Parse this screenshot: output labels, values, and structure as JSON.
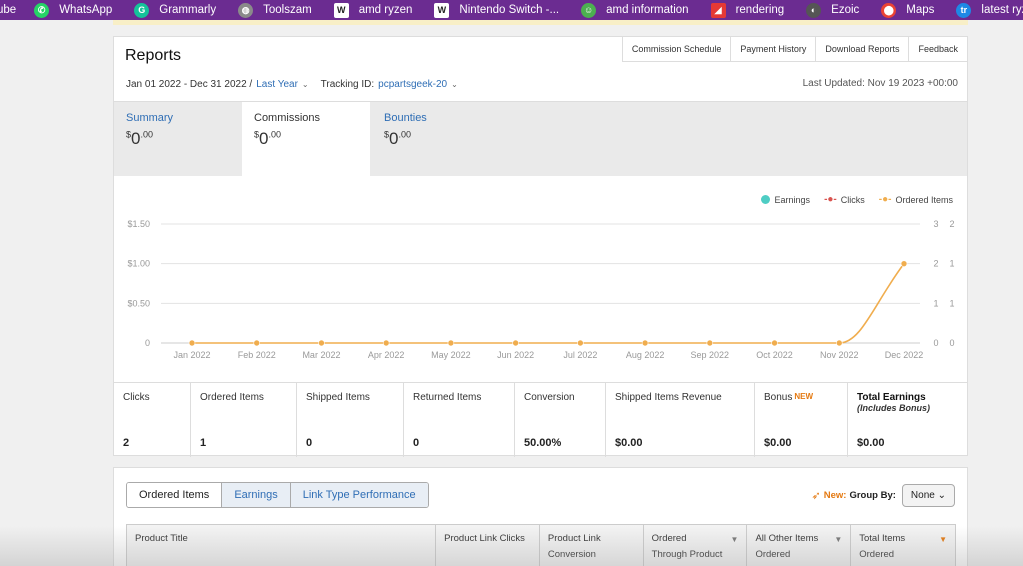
{
  "bookmarks": [
    {
      "label": "ube",
      "icon": ""
    },
    {
      "label": "WhatsApp",
      "icon": "whatsapp-icon",
      "color": "#25d366"
    },
    {
      "label": "Grammarly",
      "icon": "grammarly-icon",
      "color": "#15c39a"
    },
    {
      "label": "Toolszam",
      "icon": "globe-icon",
      "color": "#777777"
    },
    {
      "label": "amd ryzen",
      "icon": "wikipedia-icon",
      "color": "#ffffff"
    },
    {
      "label": "Nintendo Switch -...",
      "icon": "wikipedia-icon",
      "color": "#ffffff"
    },
    {
      "label": "amd information",
      "icon": "smiley-icon",
      "color": "#4caf50"
    },
    {
      "label": "rendering",
      "icon": "rendering-icon",
      "color": "#e53935"
    },
    {
      "label": "Ezoic",
      "icon": "ezoic-icon",
      "color": "#555555"
    },
    {
      "label": "Maps",
      "icon": "maps-pin-icon",
      "color": "#ea4335"
    },
    {
      "label": "latest ryzen pr",
      "icon": "tr-icon",
      "color": "#1e88e5"
    }
  ],
  "header": {
    "title": "Reports",
    "links": [
      "Commission Schedule",
      "Payment History",
      "Download Reports",
      "Feedback"
    ],
    "date_range": "Jan 01 2022 - Dec 31 2022 /",
    "period": "Last Year",
    "tracking_label": "Tracking ID:",
    "tracking_id": "pcpartsgeek-20",
    "last_updated": "Last Updated: Nov 19 2023 +00:00"
  },
  "tabs": [
    {
      "label": "Summary",
      "currency": "$",
      "whole": "0",
      "cents": ".00"
    },
    {
      "label": "Commissions",
      "currency": "$",
      "whole": "0",
      "cents": ".00"
    },
    {
      "label": "Bounties",
      "currency": "$",
      "whole": "0",
      "cents": ".00"
    }
  ],
  "legend": {
    "earnings": "Earnings",
    "clicks": "Clicks",
    "ordered": "Ordered Items"
  },
  "colors": {
    "accent": "#2f6eb5",
    "earnings": "#4ecdc4",
    "clicks": "#d9534f",
    "ordered": "#f0ad4e",
    "bookmark_bar": "#6b2c91"
  },
  "chart_data": {
    "type": "line",
    "x": [
      "Jan 2022",
      "Feb 2022",
      "Mar 2022",
      "Apr 2022",
      "May 2022",
      "Jun 2022",
      "Jul 2022",
      "Aug 2022",
      "Sep 2022",
      "Oct 2022",
      "Nov 2022",
      "Dec 2022"
    ],
    "y_left_ticks": [
      "$1.50",
      "$1.00",
      "$0.50",
      "0"
    ],
    "y_right1_ticks": [
      "3",
      "2",
      "1",
      "0"
    ],
    "y_right2_ticks": [
      "2",
      "1",
      "1",
      "0"
    ],
    "series": [
      {
        "name": "Earnings",
        "values": [
          0,
          0,
          0,
          0,
          0,
          0,
          0,
          0,
          0,
          0,
          0,
          0
        ]
      },
      {
        "name": "Clicks",
        "values": [
          0,
          0,
          0,
          0,
          0,
          0,
          0,
          0,
          0,
          0,
          0,
          2
        ]
      },
      {
        "name": "Ordered Items",
        "values": [
          0,
          0,
          0,
          0,
          0,
          0,
          0,
          0,
          0,
          0,
          0,
          1
        ]
      }
    ],
    "ylim_left": [
      0,
      1.5
    ],
    "ylim_right": [
      0,
      3
    ],
    "grid": true,
    "legend": "top-right"
  },
  "stats": [
    {
      "label": "Clicks",
      "value": "2"
    },
    {
      "label": "Ordered Items",
      "value": "1"
    },
    {
      "label": "Shipped Items",
      "value": "0"
    },
    {
      "label": "Returned Items",
      "value": "0"
    },
    {
      "label": "Conversion",
      "value": "50.00%"
    },
    {
      "label": "Shipped Items Revenue",
      "value": "$0.00"
    },
    {
      "label": "Bonus",
      "badge": "NEW",
      "value": "$0.00"
    },
    {
      "label": "Total Earnings",
      "sub": "(Includes Bonus)",
      "value": "$0.00"
    }
  ],
  "report_tabs": [
    "Ordered Items",
    "Earnings",
    "Link Type Performance"
  ],
  "group_by": {
    "new": "New:",
    "label": "Group By:",
    "value": "None"
  },
  "table_headers": [
    "Product Title",
    "Product Link Clicks",
    "Product Link Conversion",
    "Ordered Through Product Link",
    "All Other Items Ordered",
    "Total Items Ordered"
  ]
}
